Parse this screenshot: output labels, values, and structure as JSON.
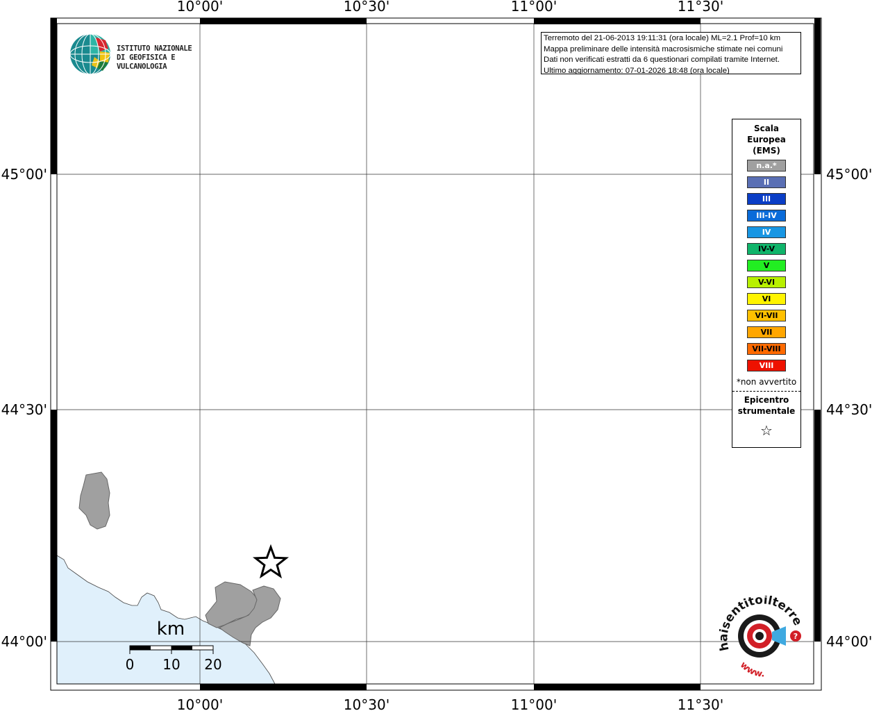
{
  "map": {
    "x_ticks": [
      "10°00'",
      "10°30'",
      "11°00'",
      "11°30'"
    ],
    "y_ticks": [
      "45°00'",
      "44°30'",
      "44°00'"
    ],
    "sea_color": "#e0f0fb",
    "land_color": "#a0a0a0"
  },
  "info_box": {
    "line1": "Terremoto del 21-06-2013 19:11:31 (ora locale) ML=2.1 Prof=10 km",
    "line2": "Mappa preliminare delle intensità macrosismiche stimate nei comuni",
    "line3": "Dati non verificati estratti da 6 questionari compilati tramite Internet.",
    "line4": "Ultimo aggiornamento: 07-01-2026 18:48 (ora locale)"
  },
  "logo": {
    "line1": "ISTITUTO NAZIONALE",
    "line2": "DI GEOFISICA E VULCANOLOGIA"
  },
  "legend": {
    "title_line1": "Scala",
    "title_line2": "Europea",
    "title_line3": "(EMS)",
    "items": [
      {
        "label": "n.a.*",
        "color": "#a0a0a0",
        "text_color": "#ffffff"
      },
      {
        "label": "II",
        "color": "#5a6fb4",
        "text_color": "#ffffff"
      },
      {
        "label": "III",
        "color": "#0b3ec6",
        "text_color": "#ffffff"
      },
      {
        "label": "III-IV",
        "color": "#0a6bd9",
        "text_color": "#ffffff"
      },
      {
        "label": "IV",
        "color": "#1896e3",
        "text_color": "#ffffff"
      },
      {
        "label": "IV-V",
        "color": "#10b46a",
        "text_color": "#000000"
      },
      {
        "label": "V",
        "color": "#22ee22",
        "text_color": "#000000"
      },
      {
        "label": "V-VI",
        "color": "#b8f000",
        "text_color": "#000000"
      },
      {
        "label": "VI",
        "color": "#fff400",
        "text_color": "#000000"
      },
      {
        "label": "VI-VII",
        "color": "#ffc000",
        "text_color": "#000000"
      },
      {
        "label": "VII",
        "color": "#ffa600",
        "text_color": "#000000"
      },
      {
        "label": "VII-VIII",
        "color": "#ff6a00",
        "text_color": "#000000"
      },
      {
        "label": "VIII",
        "color": "#ee1100",
        "text_color": "#ffffff"
      }
    ],
    "note": "*non avvertito",
    "epicentre_line1": "Epicentro",
    "epicentre_line2": "strumentale",
    "epicentre_symbol": "☆"
  },
  "scale_bar": {
    "unit": "km",
    "labels": [
      "0",
      "10",
      "20"
    ]
  },
  "haisentito": {
    "text": "haisentitoilterremoto.it",
    "prefix": "www."
  }
}
